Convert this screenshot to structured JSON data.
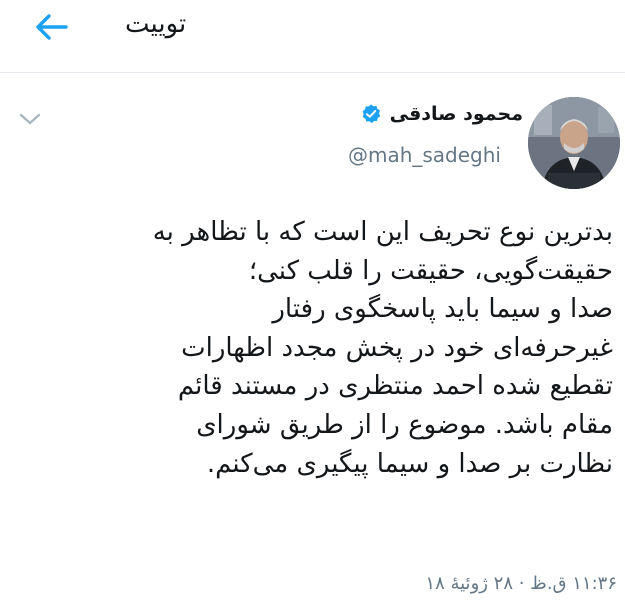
{
  "header": {
    "title": "توییت",
    "back_icon": "arrow-left-icon",
    "accent_color": "#1da1f2"
  },
  "tweet": {
    "author": {
      "display_name": "محمود صادقی",
      "handle": "@mah_sadeghi",
      "verified_icon": "verified-badge-icon",
      "avatar": "avatar"
    },
    "menu_icon": "chevron-down-icon",
    "lines": [
      "بدترین نوع تحریف این است که با تظاهر به",
      "حقیقت‌گویی، حقیقت را قلب کنی؛",
      "صدا و سیما باید پاسخگوی رفتار",
      "غیرحرفه‌ای خود در پخش مجدد اظهارات",
      "تقطیع شده احمد منتظری در مستند قائم",
      "مقام باشد. موضوع را از طریق شورای",
      "نظارت بر صدا و سیما پیگیری می‌کنم."
    ],
    "timestamp": "۱۱:۳۶ ق.ظ · ۲۸ ژوئیهٔ ۱۸"
  },
  "colors": {
    "text": "#14171a",
    "secondary": "#657786",
    "accent": "#1da1f2",
    "divider": "#e6ecf0"
  }
}
